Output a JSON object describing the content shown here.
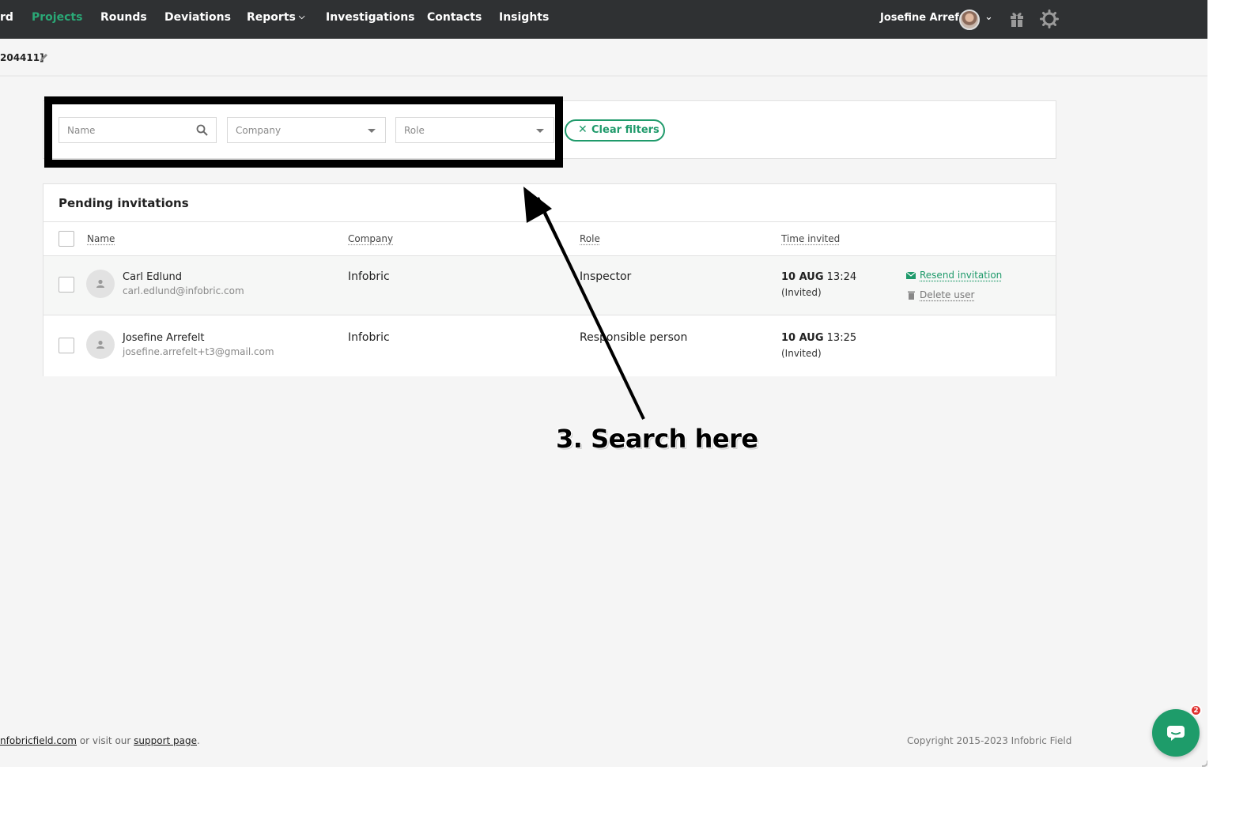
{
  "nav": {
    "items": [
      {
        "label": "rd"
      },
      {
        "label": "Projects",
        "active": true
      },
      {
        "label": "Rounds"
      },
      {
        "label": "Deviations"
      },
      {
        "label": "Reports"
      },
      {
        "label": "Investigations"
      },
      {
        "label": "Contacts"
      },
      {
        "label": "Insights"
      }
    ],
    "user_name": "Josefine Arrefelt",
    "accent_color": "#2aa876",
    "bar_color": "#2f3133"
  },
  "subbar": {
    "project_id": "204411]"
  },
  "filters": {
    "name_placeholder": "Name",
    "company_placeholder": "Company",
    "role_placeholder": "Role",
    "clear_label": "Clear filters"
  },
  "table": {
    "title": "Pending invitations",
    "columns": [
      "Name",
      "Company",
      "Role",
      "Time invited"
    ],
    "rows": [
      {
        "name": "Carl Edlund",
        "email": "carl.edlund@infobric.com",
        "company": "Infobric",
        "role": "Inspector",
        "date": "10 AUG",
        "time": "13:24",
        "status": "(Invited)",
        "actions": {
          "resend": "Resend invitation",
          "delete": "Delete user"
        }
      },
      {
        "name": "Josefine Arrefelt",
        "email": "josefine.arrefelt+t3@gmail.com",
        "company": "Infobric",
        "role": "Responsible person",
        "date": "10 AUG",
        "time": "13:25",
        "status": "(Invited)"
      }
    ]
  },
  "annotation": {
    "callout": "3. Search here"
  },
  "footer": {
    "link1": "nfobricfield.com",
    "middle": " or visit our ",
    "link2": "support page",
    "end": ".",
    "copyright": "Copyright 2015-2023 Infobric Field"
  },
  "chat": {
    "badge_count": "2",
    "color": "#1e9c6a"
  }
}
